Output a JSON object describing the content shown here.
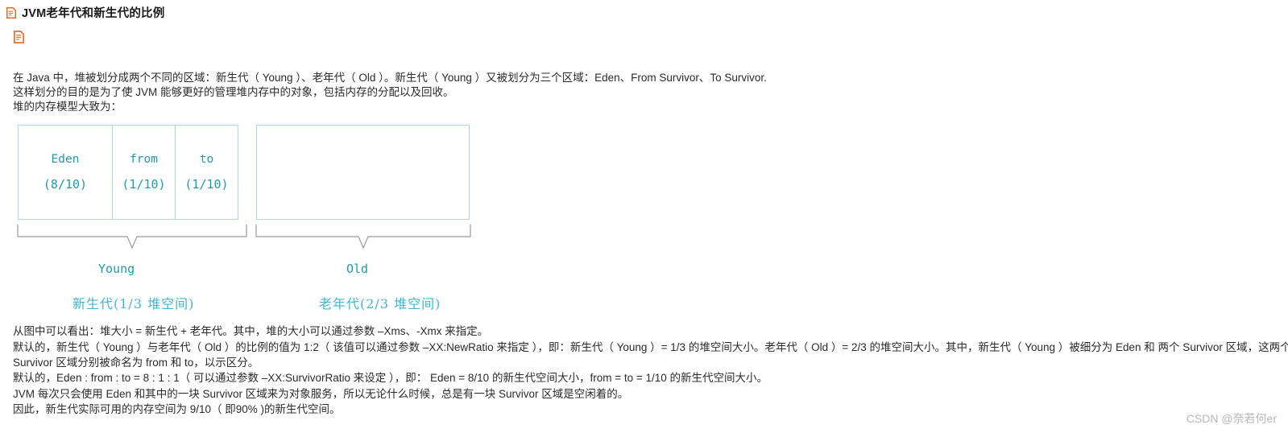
{
  "header": {
    "icon": "document-icon",
    "title": "JVM老年代和新生代的比例"
  },
  "content_icon": "document-icon",
  "intro": {
    "line1": "在 Java 中，堆被划分成两个不同的区域：新生代（ Young ）、老年代（ Old ）。新生代（ Young ）又被划分为三个区域：Eden、From Survivor、To Survivor.",
    "line2": "这样划分的目的是为了使 JVM 能够更好的管理堆内存中的对象，包括内存的分配以及回收。",
    "line3": "堆的内存模型大致为："
  },
  "diagram": {
    "cells": [
      {
        "name": "Eden",
        "ratio": "(8/10)"
      },
      {
        "name": "from",
        "ratio": "(1/10)"
      },
      {
        "name": "to",
        "ratio": "(1/10)"
      }
    ],
    "old_cell": {
      "name": "",
      "ratio": ""
    },
    "group_labels": {
      "young": "Young",
      "old": "Old"
    },
    "cn_labels": {
      "young": "新生代(1/3 堆空间)",
      "old": "老年代(2/3 堆空间)"
    },
    "colors": {
      "box_border": "#aed6f7",
      "label_text": "#1d9bb0",
      "cn_label_text": "#3fb7cf",
      "brace_line": "#9a9a9a"
    }
  },
  "details": {
    "line1": "从图中可以看出：堆大小 = 新生代 + 老年代。其中，堆的大小可以通过参数 –Xms、-Xmx 来指定。",
    "line2": "默认的，新生代（ Young ）与老年代（ Old ）的比例的值为 1:2（ 该值可以通过参数 –XX:NewRatio 来指定 ），即：新生代（ Young ）= 1/3 的堆空间大小。老年代（ Old ）= 2/3 的堆空间大小。其中，新生代（ Young ）被细分为 Eden 和 两个 Survivor 区域，这两个",
    "line3": "Survivor 区域分别被命名为 from 和 to，以示区分。",
    "line4": "默认的，Eden : from : to = 8 : 1 : 1（ 可以通过参数 –XX:SurvivorRatio 来设定 ），即： Eden = 8/10 的新生代空间大小，from = to = 1/10 的新生代空间大小。",
    "line5": "JVM 每次只会使用 Eden 和其中的一块 Survivor 区域来为对象服务，所以无论什么时候，总是有一块 Survivor 区域是空闲着的。",
    "line6": "因此，新生代实际可用的内存空间为 9/10（ 即90% )的新生代空间。"
  },
  "watermark": "CSDN @奈若何er"
}
